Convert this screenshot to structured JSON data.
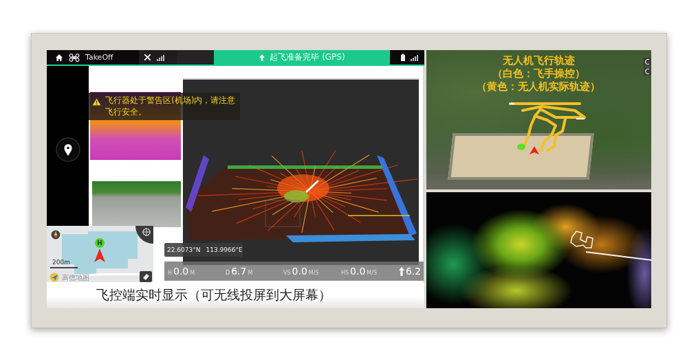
{
  "flight_app": {
    "top_bar": {
      "mode": "TakeOff",
      "status": "起飞准备完毕 (GPS)"
    },
    "warning": "飞行器处于警告区(机场)内，请注意飞行安全。",
    "map": {
      "home_marker": "H",
      "scale": "200m",
      "provider": "高德地图"
    },
    "coordinates": [
      "22.6073°N",
      "113.9966°E"
    ],
    "telemetry": [
      {
        "kind": "reading",
        "label": "H",
        "value": "0.0",
        "unit": "M"
      },
      {
        "kind": "reading",
        "label": "D",
        "value": "6.7",
        "unit": "M"
      },
      {
        "kind": "reading",
        "label": "VS",
        "value": "0.0",
        "unit": "M/S"
      },
      {
        "kind": "reading",
        "label": "HS",
        "value": "0.0",
        "unit": "M/S"
      },
      {
        "kind": "icon_reading",
        "value": "6.2"
      }
    ]
  },
  "caption": "飞控端实时显示（可无线投屏到大屏幕）",
  "track_photo": {
    "legend": [
      "无人机飞行轨迹",
      "（白色：飞手操控）",
      "（黄色：无人机实际轨迹）"
    ]
  }
}
